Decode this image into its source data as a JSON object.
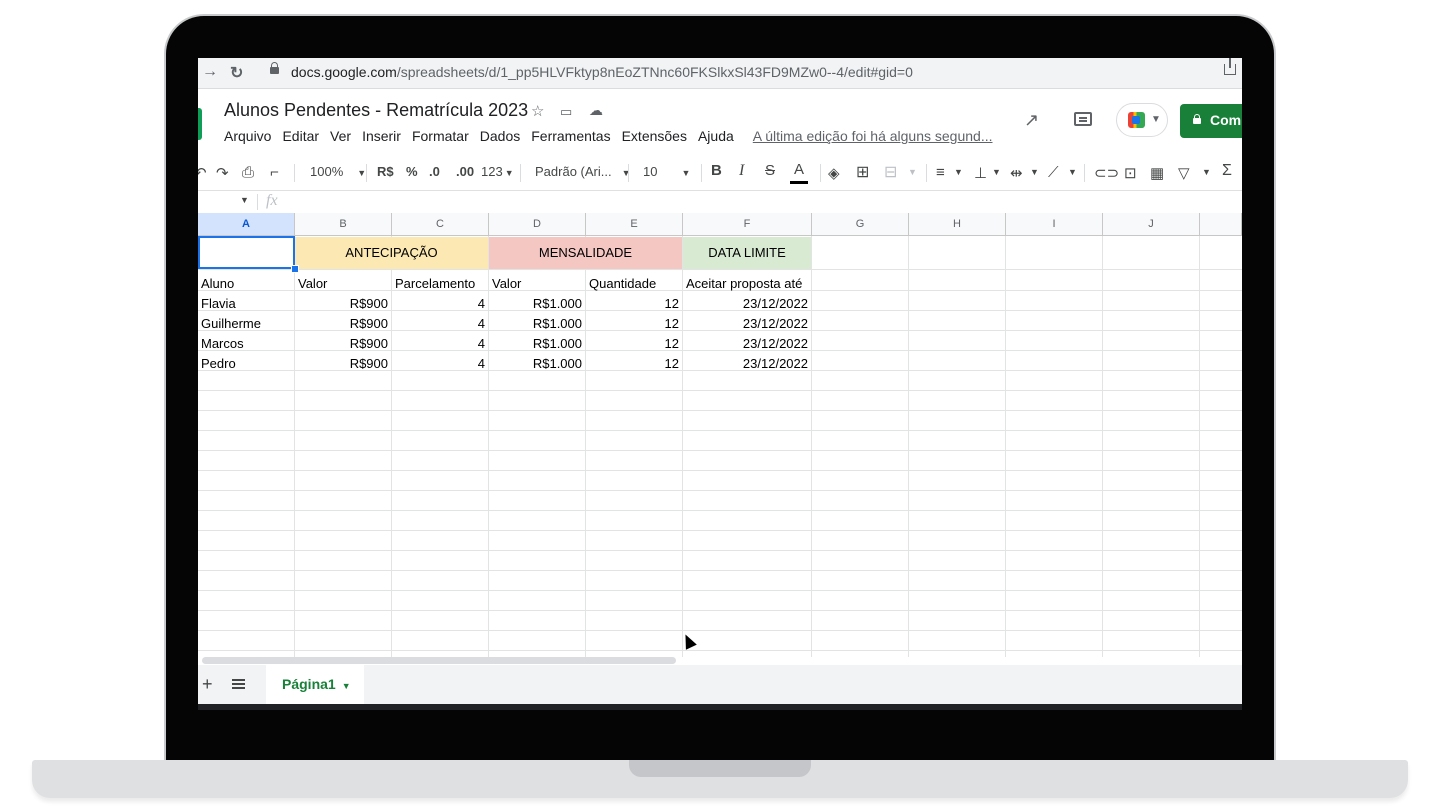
{
  "browser": {
    "url_host": "docs.google.com",
    "url_path": "/spreadsheets/d/1_pp5HLVFktyp8nEoZTNnc60FKSlkxSl43FD9MZw0--4/edit#gid=0"
  },
  "doc": {
    "title": "Alunos Pendentes - Rematrícula 2023",
    "menu": [
      "Arquivo",
      "Editar",
      "Ver",
      "Inserir",
      "Formatar",
      "Dados",
      "Ferramentas",
      "Extensões",
      "Ajuda"
    ],
    "last_edit": "A última edição foi há alguns segund...",
    "share_label": "Com"
  },
  "toolbar": {
    "zoom": "100%",
    "currency": "R$",
    "percent": "%",
    "dec_decrease": ".0",
    "dec_increase": ".00",
    "more_formats": "123",
    "font": "Padrão (Ari...",
    "font_size": "10",
    "bold": "B",
    "italic": "I",
    "strike": "S",
    "text_color": "A",
    "sum": "Σ"
  },
  "formula_bar": {
    "fx": "fx"
  },
  "columns": [
    "A",
    "B",
    "C",
    "D",
    "E",
    "F",
    "G",
    "H",
    "I",
    "J"
  ],
  "selected_column": "A",
  "group_headers": [
    {
      "label": "ANTECIPAÇÃO",
      "color": "#fce8b2"
    },
    {
      "label": "MENSALIDADE",
      "color": "#f4c7c3"
    },
    {
      "label": "DATA LIMITE",
      "color": "#d9ead3"
    }
  ],
  "table": {
    "headers": [
      "Aluno",
      "Valor",
      "Parcelamento",
      "Valor",
      "Quantidade",
      "Aceitar proposta até"
    ],
    "rows": [
      [
        "Flavia",
        "R$900",
        "4",
        "R$1.000",
        "12",
        "23/12/2022"
      ],
      [
        "Guilherme",
        "R$900",
        "4",
        "R$1.000",
        "12",
        "23/12/2022"
      ],
      [
        "Marcos",
        "R$900",
        "4",
        "R$1.000",
        "12",
        "23/12/2022"
      ],
      [
        "Pedro",
        "R$900",
        "4",
        "R$1.000",
        "12",
        "23/12/2022"
      ]
    ]
  },
  "sheets": [
    {
      "name": "Página1",
      "active": true
    }
  ],
  "colors": {
    "accent": "#188038",
    "selection": "#1a73e8"
  }
}
